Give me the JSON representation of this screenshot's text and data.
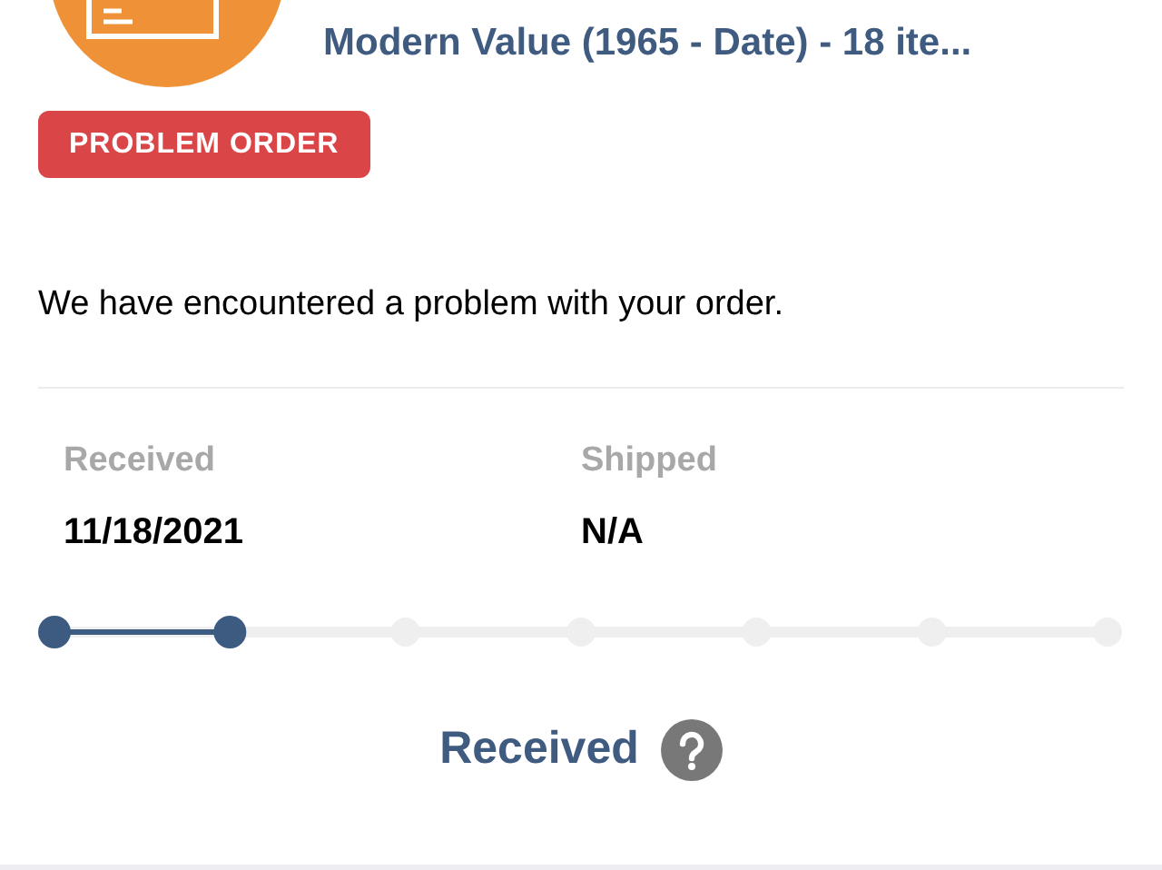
{
  "order": {
    "title": "Modern Value (1965 - Date) - 18 ite...",
    "status_badge": "PROBLEM ORDER",
    "message": "We have encountered a problem with your order."
  },
  "dates": [
    {
      "label": "Received",
      "value": "11/18/2021"
    },
    {
      "label": "Shipped",
      "value": "N/A"
    }
  ],
  "progress": {
    "steps": [
      {
        "done": true
      },
      {
        "done": true
      },
      {
        "done": false
      },
      {
        "done": false
      },
      {
        "done": false
      },
      {
        "done": false
      },
      {
        "done": false
      }
    ],
    "current_label": "Received"
  }
}
